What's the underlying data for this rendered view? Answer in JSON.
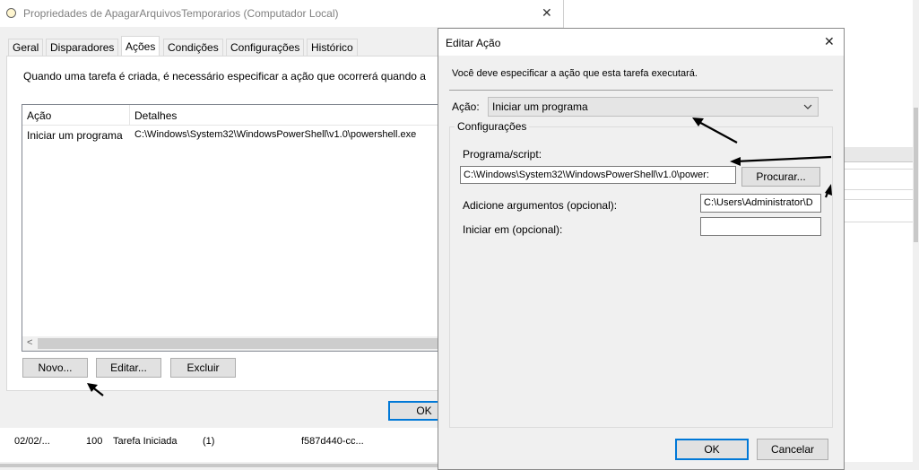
{
  "main_window": {
    "title": "Propriedades de ApagarArquivosTemporarios (Computador Local)",
    "close_glyph": "✕",
    "tabs": [
      {
        "label": "Geral"
      },
      {
        "label": "Disparadores"
      },
      {
        "label": "Ações"
      },
      {
        "label": "Condições"
      },
      {
        "label": "Configurações"
      },
      {
        "label": "Histórico"
      }
    ],
    "intro_text": "Quando uma tarefa é criada, é necessário especificar a ação que ocorrerá quando a",
    "table": {
      "columns": [
        "Ação",
        "Detalhes"
      ],
      "rows": [
        {
          "action": "Iniciar um programa",
          "details": "C:\\Windows\\System32\\WindowsPowerShell\\v1.0\\powershell.exe"
        }
      ]
    },
    "buttons": {
      "new": "Novo...",
      "edit": "Editar...",
      "delete": "Excluir",
      "ok": "OK"
    },
    "scroll_left_glyph": "<"
  },
  "background_list": {
    "row": {
      "date": "02/02/...",
      "id": "100",
      "category": "Tarefa Iniciada",
      "op": "(1)",
      "guid": "f587d440-cc..."
    }
  },
  "dialog": {
    "title": "Editar Ação",
    "close_glyph": "✕",
    "instruction": "Você deve especificar a ação que esta tarefa executará.",
    "action_label": "Ação:",
    "action_value": "Iniciar um programa",
    "settings_group": "Configurações",
    "program_label": "Programa/script:",
    "program_value": "C:\\Windows\\System32\\WindowsPowerShell\\v1.0\\power:",
    "browse_label": "Procurar...",
    "args_label": "Adicione argumentos (opcional):",
    "args_value": "C:\\Users\\Administrator\\D",
    "start_in_label": "Iniciar em (opcional):",
    "start_in_value": "",
    "ok_label": "OK",
    "cancel_label": "Cancelar"
  },
  "colors": {
    "accent": "#0078d7",
    "window_bg": "#f0f0f0",
    "annotation": "#000000"
  }
}
